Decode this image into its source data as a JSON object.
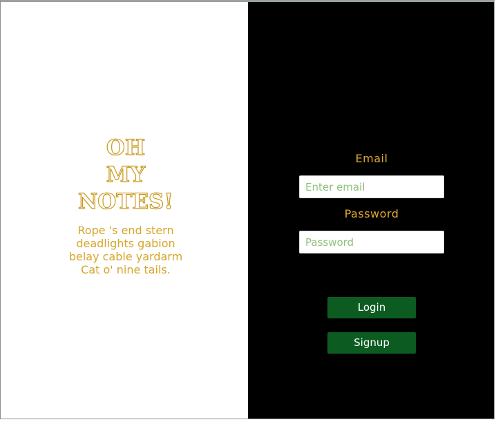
{
  "brand": {
    "lines": [
      "OH",
      "MY",
      "NOTES!"
    ]
  },
  "tagline": "Rope 's end stern deadlights gabion belay cable yardarm Cat o' nine tails.",
  "form": {
    "email_label": "Email",
    "email_placeholder": "Enter email",
    "email_value": "",
    "password_label": "Password",
    "password_placeholder": "Password",
    "password_value": "",
    "login_label": "Login",
    "signup_label": "Signup"
  },
  "colors": {
    "accent_gold": "#d6a52a",
    "button_green": "#0c5c22",
    "right_panel_bg": "#000000",
    "left_panel_bg": "#ffffff"
  }
}
